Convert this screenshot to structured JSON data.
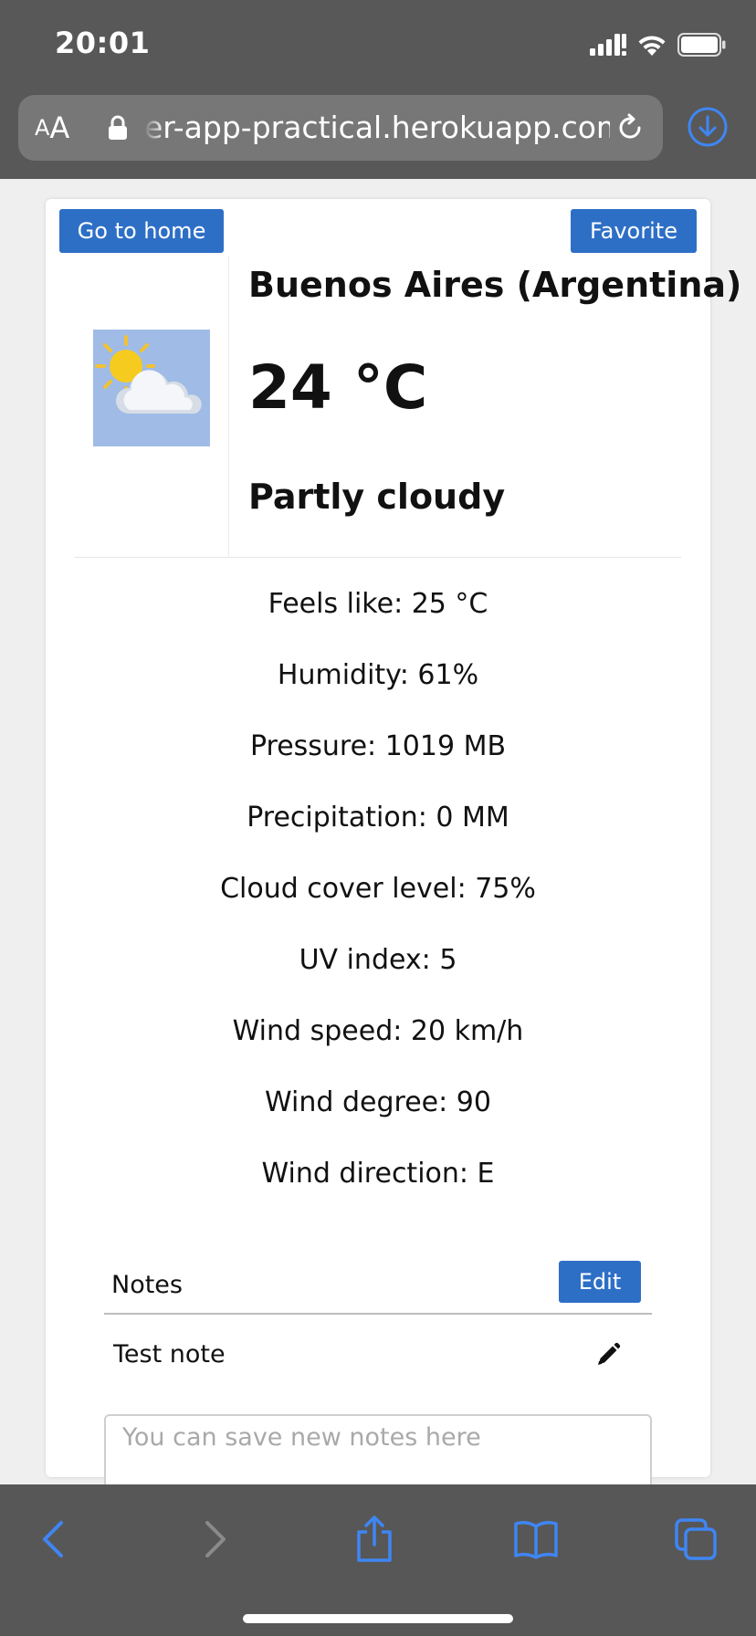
{
  "status_bar": {
    "time": "20:01"
  },
  "browser": {
    "text_size_small": "A",
    "text_size_large": "A",
    "url": "er-app-practical.herokuapp.com",
    "icons": [
      "lock-icon",
      "reload-icon",
      "download-icon"
    ],
    "toolbar_icons": [
      "back-icon",
      "forward-icon",
      "share-icon",
      "bookmarks-icon",
      "tabs-icon"
    ],
    "accent_color": "#3f86f4"
  },
  "page": {
    "home_button": "Go to home",
    "favorite_button": "Favorite",
    "city": "Buenos Aires (Argentina)",
    "temperature": "24 °C",
    "condition": "Partly cloudy",
    "weather_icon": "partly-cloudy-icon",
    "button_color": "#2e6fc6",
    "details": [
      "Feels like: 25 °C",
      "Humidity: 61%",
      "Pressure: 1019 MB",
      "Precipitation: 0 MM",
      "Cloud cover level: 75%",
      "UV index: 5",
      "Wind speed: 20 km/h",
      "Wind degree: 90",
      "Wind direction: E"
    ],
    "notes": {
      "title": "Notes",
      "edit_button": "Edit",
      "items": [
        "Test note"
      ],
      "input_placeholder": "You can save new notes here"
    }
  }
}
